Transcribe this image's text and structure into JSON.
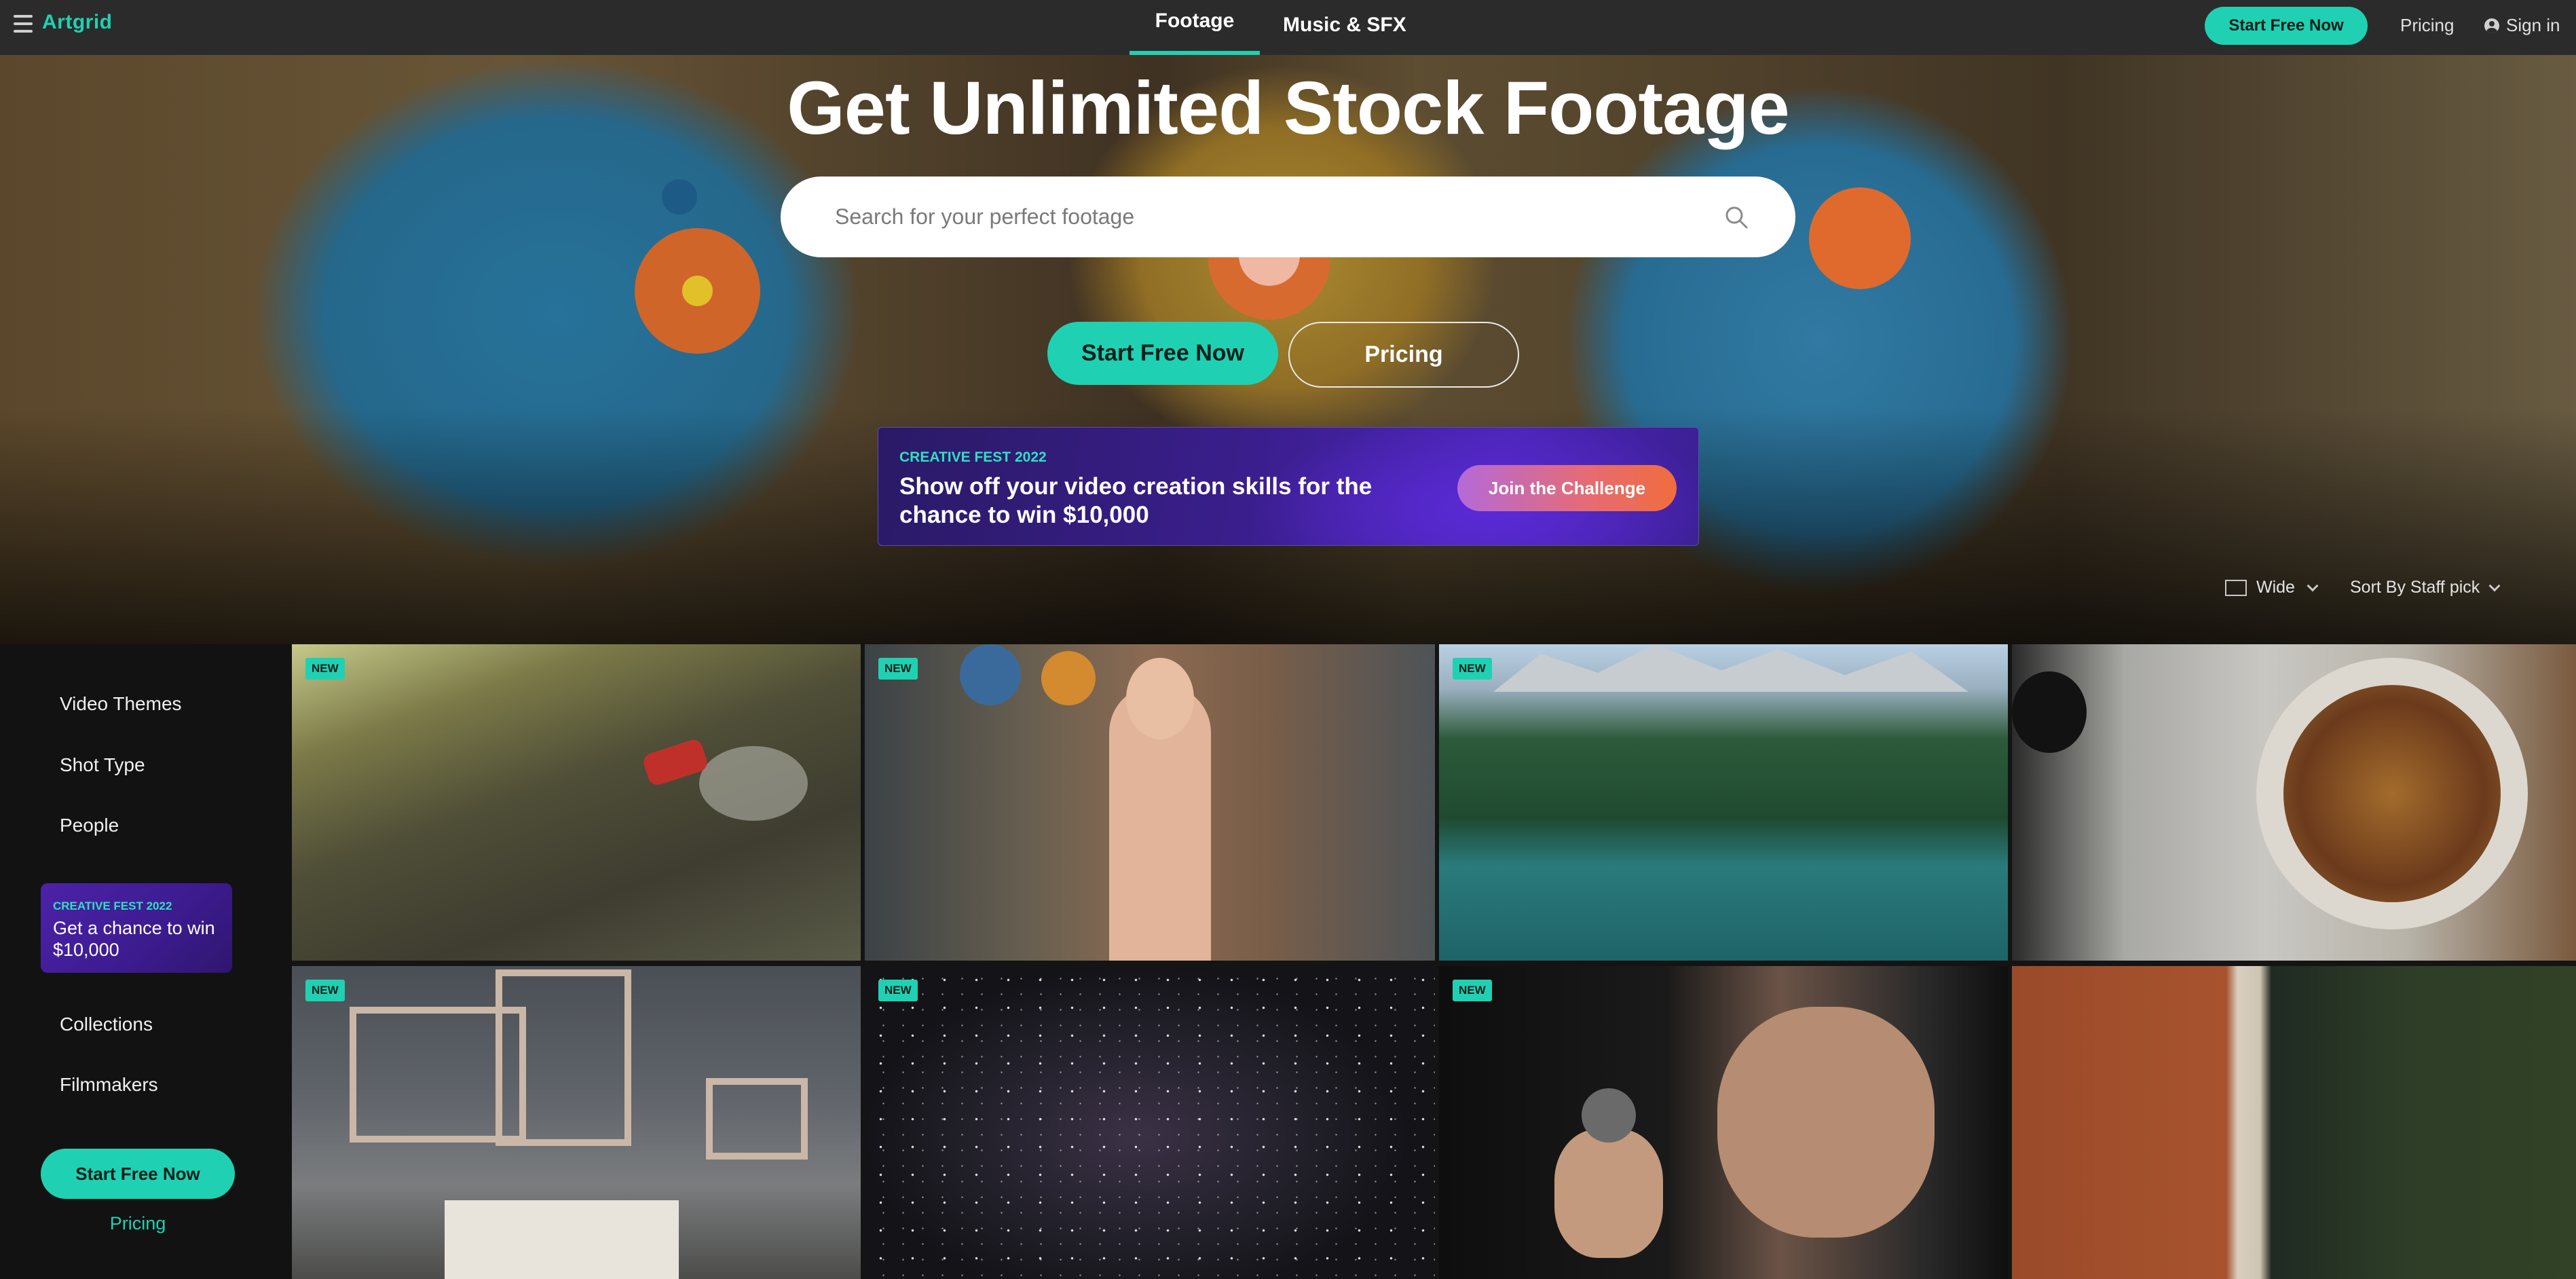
{
  "topnav": {
    "logo": "Artgrid",
    "tabs": [
      {
        "label": "Footage",
        "active": true
      },
      {
        "label": "Music & SFX",
        "active": false
      }
    ],
    "start_label": "Start Free Now",
    "pricing_label": "Pricing",
    "signin_label": "Sign in"
  },
  "hero": {
    "title": "Get Unlimited Stock Footage",
    "search_placeholder": "Search for your perfect footage",
    "start_label": "Start Free Now",
    "pricing_label": "Pricing",
    "banner": {
      "kicker": "CREATIVE FEST 2022",
      "headline": "Show off your video creation skills for the chance to win $10,000",
      "cta": "Join the Challenge"
    },
    "view_label": "Wide",
    "sort_label": "Sort By Staff pick"
  },
  "sidebar": {
    "items": [
      {
        "label": "Video Themes"
      },
      {
        "label": "Shot Type"
      },
      {
        "label": "People"
      },
      {
        "label": "Collections"
      },
      {
        "label": "Filmmakers"
      }
    ],
    "promo": {
      "kicker": "CREATIVE FEST 2022",
      "text": "Get a chance to win $10,000"
    },
    "start_label": "Start Free Now",
    "pricing_label": "Pricing"
  },
  "grid": {
    "badge_label": "NEW",
    "tiles": [
      {
        "badge": true
      },
      {
        "badge": true
      },
      {
        "badge": true
      },
      {
        "badge": false
      },
      {
        "badge": true
      },
      {
        "badge": true
      },
      {
        "badge": true
      },
      {
        "badge": false
      }
    ]
  },
  "colors": {
    "accent": "#1fd1b2",
    "nav_bg": "#2b2b2b",
    "page_bg": "#141414",
    "promo_purple": "#3c1b8e"
  },
  "icons": [
    "menu-icon",
    "search-icon",
    "user-icon",
    "wide-view-icon",
    "chevron-down-icon"
  ]
}
